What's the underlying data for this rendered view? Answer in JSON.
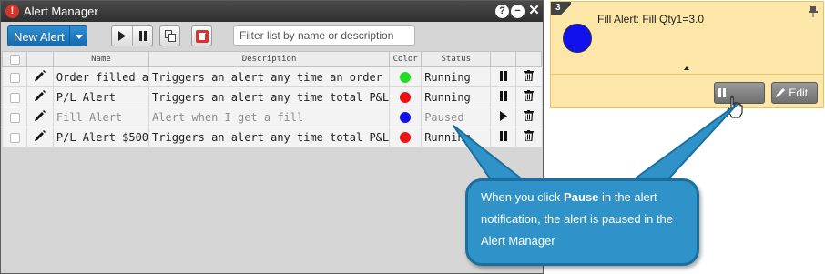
{
  "window": {
    "title": "Alert Manager",
    "controls": {
      "help": "?",
      "minimize": "−",
      "close": "✕"
    }
  },
  "toolbar": {
    "new_alert_label": "New Alert",
    "play_icon": "play-icon",
    "pause_icon": "pause-icon",
    "copy_icon": "copy-icon",
    "delete_icon": "trash-icon",
    "search_placeholder": "Filter list by name or description"
  },
  "table": {
    "columns": [
      "Name",
      "Description",
      "Color",
      "Status"
    ],
    "rows": [
      {
        "name": "Order filled a",
        "description": "Triggers an alert any time an order",
        "color": "#22dd22",
        "status": "Running",
        "action": "pause"
      },
      {
        "name": "P/L Alert",
        "description": "Triggers an alert any time total P&L",
        "color": "#ee1111",
        "status": "Running",
        "action": "pause"
      },
      {
        "name": "Fill Alert",
        "description": "Alert when I get a fill",
        "color": "#1111ee",
        "status": "Paused",
        "action": "play"
      },
      {
        "name": "P/L Alert $500",
        "description": "Triggers an alert any time total P&L",
        "color": "#ee1111",
        "status": "Running",
        "action": "pause"
      }
    ]
  },
  "notification": {
    "number": "3",
    "title": "Fill Alert: Fill Qty1=3.0",
    "color": "#1111ee",
    "pause_label": "Pause",
    "edit_label": "Edit"
  },
  "callout": {
    "text_before": "When you click ",
    "text_bold": "Pause",
    "text_after": " in the alert notification, the alert is paused in the Alert Manager"
  },
  "colors": {
    "accent": "#1f7fc4",
    "callout_bg": "#2f92c8",
    "notification_bg": "#fde7a8"
  }
}
